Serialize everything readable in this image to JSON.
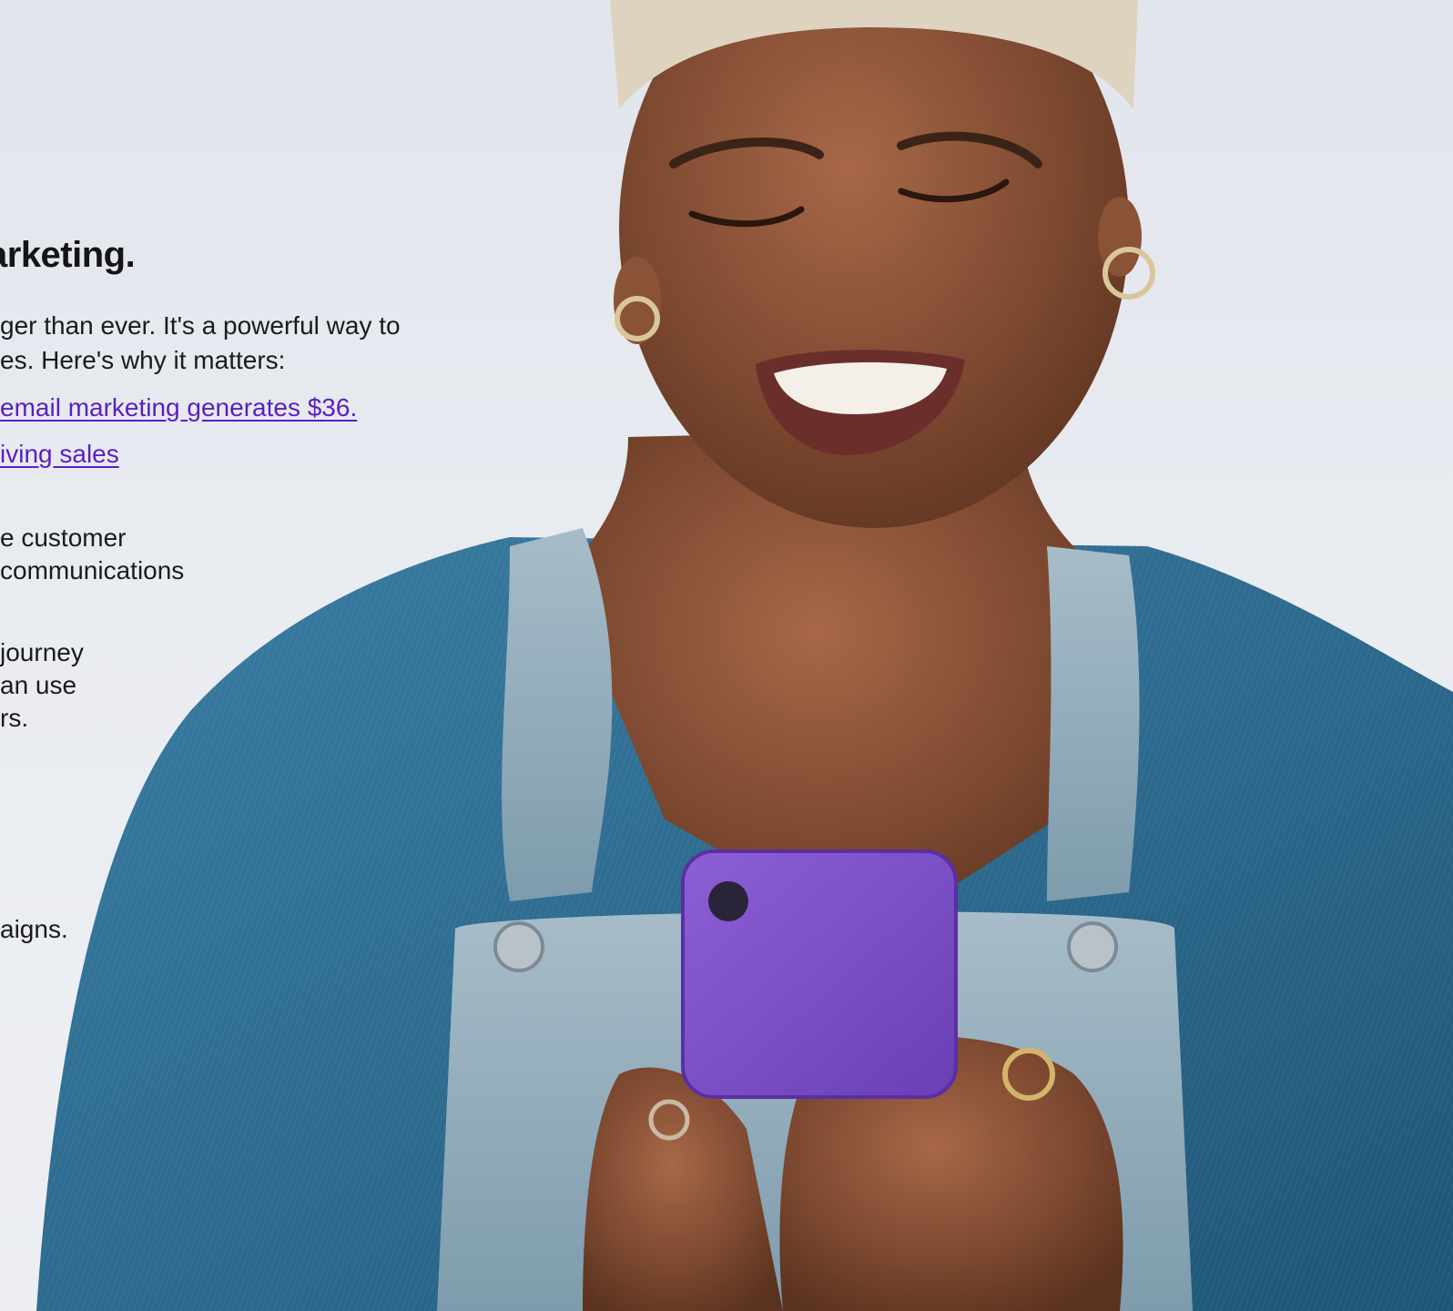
{
  "article": {
    "heading": "arketing.",
    "intro_lines": [
      "ger than ever. It's a powerful way to",
      "es. Here's why it matters:"
    ],
    "links": [
      " email marketing generates $36.",
      "iving sales"
    ],
    "paragraph_1": [
      "e customer",
      " communications"
    ],
    "paragraph_2": [
      "journey",
      "an use",
      "rs."
    ],
    "paragraph_3": [
      "aigns."
    ]
  },
  "colors": {
    "link": "#5b1fbf",
    "phone": "#7b4ec7",
    "shirt": "#2f6e92",
    "overalls": "#8ca9b8",
    "background": "#e6e9ef"
  }
}
